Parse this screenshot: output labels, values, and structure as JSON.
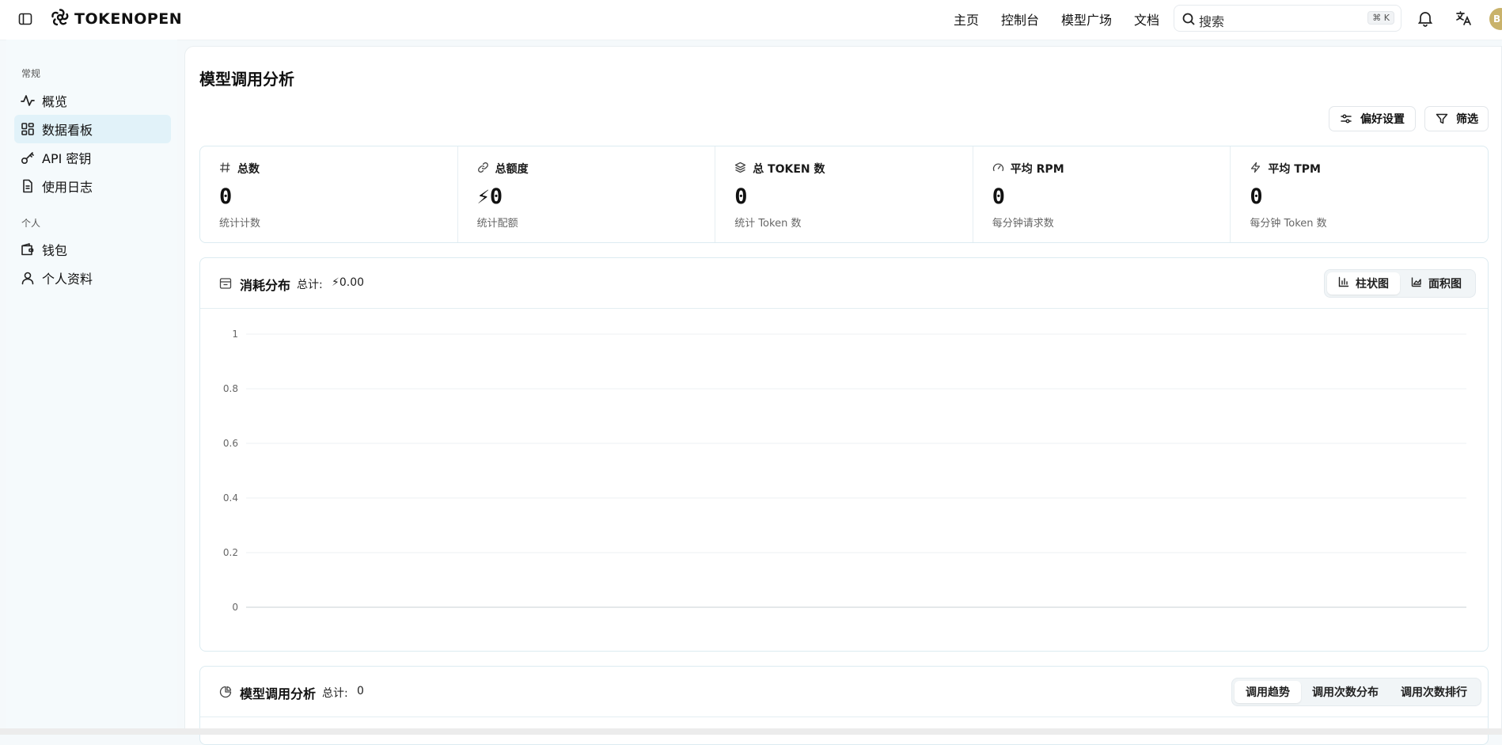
{
  "header": {
    "logo_text": "TOKENOPEN",
    "nav": [
      "主页",
      "控制台",
      "模型广场",
      "文档"
    ],
    "search_placeholder": "搜索",
    "search_shortcut": "⌘ K",
    "avatar_initial": "B"
  },
  "sidebar": {
    "section_general": "常规",
    "section_personal": "个人",
    "items": [
      {
        "label": "概览",
        "icon": "activity-icon"
      },
      {
        "label": "数据看板",
        "icon": "grid-icon",
        "active": true
      },
      {
        "label": "API 密钥",
        "icon": "key-icon"
      },
      {
        "label": "使用日志",
        "icon": "file-text-icon"
      },
      {
        "label": "钱包",
        "icon": "wallet-icon"
      },
      {
        "label": "个人资料",
        "icon": "user-icon"
      }
    ]
  },
  "page": {
    "title": "模型调用分析",
    "preferences_label": "偏好设置",
    "filter_label": "筛选"
  },
  "stats": [
    {
      "title": "总数",
      "value": "0",
      "sub": "统计计数",
      "icon": "hash-icon"
    },
    {
      "title": "总额度",
      "value": "⚡0",
      "sub": "统计配额",
      "icon": "link-icon"
    },
    {
      "title": "总 TOKEN 数",
      "value": "0",
      "sub": "统计 Token 数",
      "icon": "layers-icon"
    },
    {
      "title": "平均 RPM",
      "value": "0",
      "sub": "每分钟请求数",
      "icon": "gauge-icon"
    },
    {
      "title": "平均 TPM",
      "value": "0",
      "sub": "每分钟 Token 数",
      "icon": "zap-icon"
    }
  ],
  "consumption": {
    "title": "消耗分布",
    "total_label": "总计:",
    "total_value": "⚡0.00",
    "tabs": [
      "柱状图",
      "面积图"
    ],
    "active_tab": "柱状图"
  },
  "model_analysis": {
    "title": "模型调用分析",
    "total_label": "总计:",
    "total_value": "0",
    "tabs": [
      "调用趋势",
      "调用次数分布",
      "调用次数排行"
    ],
    "active_tab": "调用趋势"
  },
  "chart_data": {
    "type": "bar",
    "categories": [],
    "values": [],
    "title": "",
    "xlabel": "",
    "ylabel": "",
    "ylim": [
      0,
      1
    ],
    "yticks": [
      "1",
      "0.8",
      "0.6",
      "0.4",
      "0.2",
      "0"
    ],
    "grid": true
  },
  "colors": {
    "accent_bg": "#e1f2f9",
    "border": "#dcebf1",
    "avatar": "#c9b26a",
    "lightning": "#e8b820"
  }
}
